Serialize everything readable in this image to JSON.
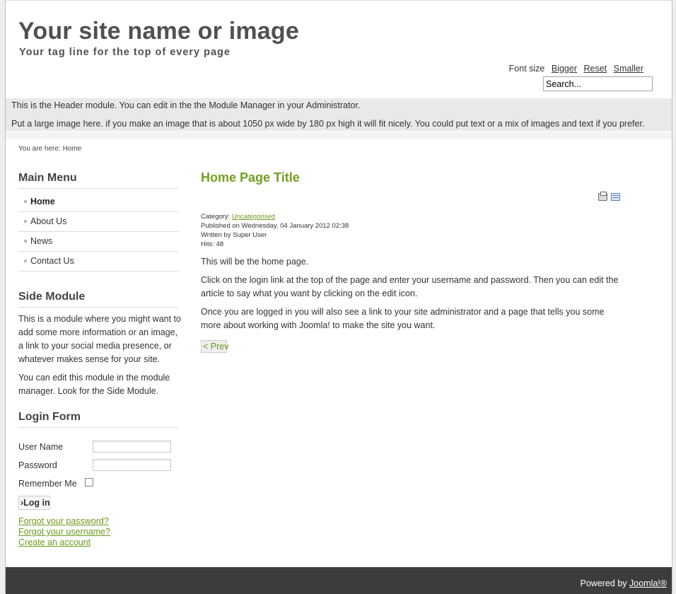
{
  "header": {
    "site_name": "Your site name or image",
    "tagline": "Your tag line for the top of every page",
    "font_size": {
      "label": "Font size",
      "bigger": "Bigger",
      "reset": "Reset",
      "smaller": "Smaller"
    },
    "search": {
      "value": "Search..."
    }
  },
  "header_module": {
    "line1": "This is the Header module. You can edit in the the Module Manager in your Administrator.",
    "line2": "Put a large image here. if you make an image that is about 1050 px wide  by  180 px high it will fit nicely. You could put text or a mix of images and text if you prefer."
  },
  "breadcrumb": {
    "prefix": "You are here:",
    "current": "Home"
  },
  "main_menu": {
    "title": "Main Menu",
    "items": [
      {
        "label": "Home",
        "active": true
      },
      {
        "label": "About Us"
      },
      {
        "label": "News"
      },
      {
        "label": "Contact Us"
      }
    ]
  },
  "side_module": {
    "title": "Side Module",
    "para1": "This is a module where you might want to add some more information or an image,  a link to your social media presence, or whatever makes sense for your site.",
    "para2": "You can edit this module in the module manager. Look for the Side Module."
  },
  "login_form": {
    "title": "Login Form",
    "username_label": "User Name",
    "password_label": "Password",
    "remember_label": "Remember Me",
    "login_button": "›Log in",
    "forgot_password": "Forgot your password?",
    "forgot_username": "Forgot your username?",
    "create_account": "Create an account"
  },
  "article": {
    "title": "Home Page Title",
    "category_label": "Category:",
    "category": "Uncategorised",
    "published": "Published on Wednesday, 04 January 2012 02:38",
    "written_by": "Written by Super User",
    "hits": "Hits: 48",
    "para1": "This will be the home page.",
    "para2": "Click on the login link at the top of the page and enter your username and password. Then you can edit the article to say what you want by clicking on the edit icon.",
    "para3": "Once you are logged in you will also see a link to your site administrator and a page that tells you some more about working with Joomla! to make the site you want.",
    "prev_button": "< Prev",
    "icons": [
      "print-icon",
      "email-icon"
    ]
  },
  "footer": {
    "powered_by": "Powered by",
    "link": "Joomla!®"
  },
  "colors": {
    "accent_green": "#72a021",
    "footer_bg": "#3c3c3c",
    "header_module_bg": "#e8eae7"
  }
}
